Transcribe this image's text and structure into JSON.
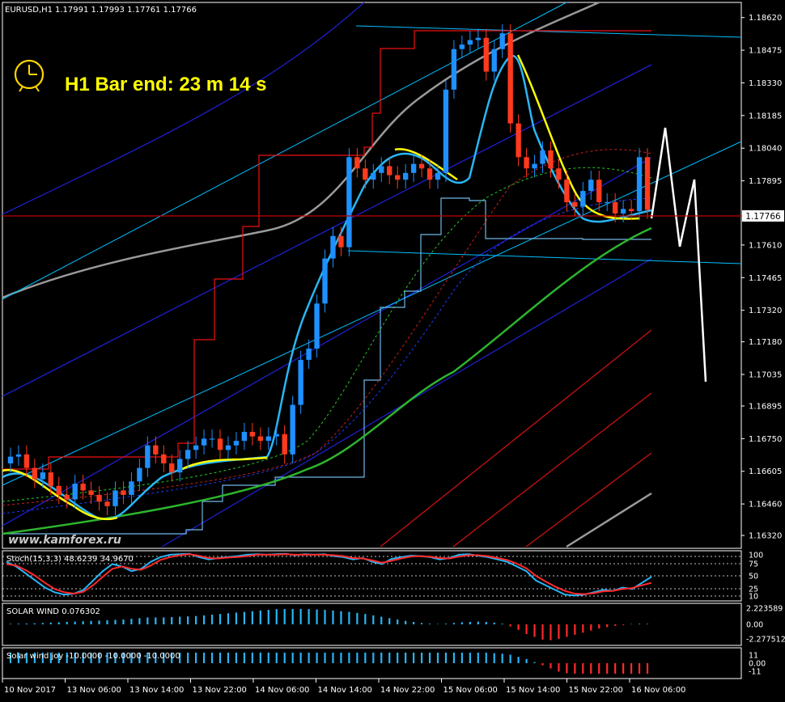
{
  "header": {
    "symbol": "EURUSD,H1",
    "ohlc": "1.17991 1.17993 1.17761 1.17766"
  },
  "timer": {
    "label": "H1 Bar end: 23 m 14 s",
    "icon": "clock-icon"
  },
  "watermark": "www.kamforex.ru",
  "colors": {
    "bull": "#1e90ff",
    "bear": "#ff3a1e",
    "price_line": "#c00000",
    "trend_line": "#00bfff",
    "channel": "#1e1ecc",
    "donchian": "#ff0000",
    "wave": "#1e90ff",
    "signal": "#ffff00",
    "ma_slow": "#2db52d",
    "ma_grey": "#9a9a9a",
    "forecast": "#ffffff",
    "ask_box": "#ff0000"
  },
  "price_marker": "1.17766",
  "chart_data": [
    {
      "type": "candlestick",
      "title": "EURUSD,H1",
      "y_ticks": [
        "1.18620",
        "1.18475",
        "1.18330",
        "1.18185",
        "1.18040",
        "1.17895",
        "1.17610",
        "1.17465",
        "1.17320",
        "1.17180",
        "1.17035",
        "1.16895",
        "1.16750",
        "1.16605",
        "1.16460",
        "1.16320"
      ],
      "ylim": [
        1.1627,
        1.1868
      ],
      "x_ticks": [
        "10 Nov 2017",
        "13 Nov 06:00",
        "13 Nov 14:00",
        "13 Nov 22:00",
        "14 Nov 06:00",
        "14 Nov 14:00",
        "14 Nov 22:00",
        "15 Nov 06:00",
        "15 Nov 14:00",
        "15 Nov 22:00",
        "16 Nov 06:00"
      ],
      "current_price": 1.17766,
      "close": [
        1.1667,
        1.1668,
        1.1662,
        1.1657,
        1.166,
        1.1654,
        1.165,
        1.1648,
        1.1655,
        1.1652,
        1.165,
        1.1647,
        1.1645,
        1.1652,
        1.165,
        1.1656,
        1.1662,
        1.1672,
        1.1668,
        1.1664,
        1.166,
        1.1666,
        1.167,
        1.1672,
        1.1675,
        1.1675,
        1.167,
        1.1672,
        1.1674,
        1.1678,
        1.1676,
        1.1674,
        1.1676,
        1.1677,
        1.1668,
        1.169,
        1.171,
        1.1715,
        1.1735,
        1.1755,
        1.1765,
        1.176,
        1.18,
        1.1795,
        1.179,
        1.1793,
        1.1796,
        1.1792,
        1.179,
        1.1793,
        1.1797,
        1.1795,
        1.179,
        1.1793,
        1.183,
        1.1848,
        1.185,
        1.1852,
        1.1853,
        1.1838,
        1.1848,
        1.1855,
        1.1815,
        1.18,
        1.1795,
        1.1797,
        1.1803,
        1.1795,
        1.179,
        1.178,
        1.1778,
        1.1785,
        1.179,
        1.178,
        1.178,
        1.1775,
        1.1777,
        1.1776,
        1.18,
        1.17766
      ]
    },
    {
      "type": "line",
      "title": "Stoch(15,3,3)",
      "values_text": "48.6239 34.9670",
      "y_ticks": [
        "100",
        "75",
        "50",
        "25",
        "10"
      ],
      "ylim": [
        0,
        100
      ],
      "series": [
        {
          "values": [
            80,
            70,
            55,
            40,
            25,
            15,
            10,
            12,
            20,
            40,
            60,
            75,
            70,
            60,
            65,
            80,
            90,
            95,
            96,
            97,
            90,
            85,
            88,
            90,
            92,
            95,
            96,
            95,
            96,
            97,
            94,
            96,
            95,
            96,
            92,
            90,
            85,
            88,
            80,
            75,
            86,
            90,
            93,
            92,
            90,
            85,
            88,
            95,
            96,
            93,
            90,
            85,
            80,
            70,
            60,
            40,
            30,
            20,
            10,
            8,
            10,
            15,
            20,
            18,
            25,
            22,
            35,
            48
          ]
        },
        {
          "values": [
            75,
            72,
            62,
            50,
            35,
            22,
            15,
            12,
            16,
            30,
            48,
            65,
            70,
            65,
            63,
            72,
            84,
            90,
            94,
            96,
            93,
            88,
            87,
            89,
            90,
            92,
            95,
            95,
            95,
            96,
            95,
            95,
            95,
            95,
            94,
            92,
            88,
            87,
            83,
            78,
            82,
            87,
            91,
            92,
            91,
            88,
            87,
            91,
            94,
            94,
            92,
            88,
            84,
            76,
            66,
            50,
            38,
            27,
            18,
            12,
            11,
            13,
            17,
            18,
            22,
            24,
            30,
            35
          ]
        }
      ]
    },
    {
      "type": "bar",
      "title": "SOLAR WIND",
      "values_text": "0.076302",
      "y_ticks": [
        "2.223589",
        "0.00",
        "-2.277512"
      ],
      "ylim": [
        -2.8,
        2.8
      ],
      "values": [
        0.08,
        0.1,
        0.12,
        0.15,
        0.2,
        0.25,
        0.3,
        0.35,
        0.4,
        0.45,
        0.5,
        0.55,
        0.6,
        0.65,
        0.7,
        0.8,
        0.9,
        1.0,
        1.0,
        1.0,
        1.05,
        1.1,
        1.15,
        1.2,
        1.3,
        1.4,
        1.5,
        1.6,
        1.7,
        1.8,
        1.9,
        2.0,
        2.1,
        2.2,
        2.22,
        2.22,
        2.22,
        2.2,
        2.15,
        2.1,
        2.0,
        1.9,
        1.8,
        1.65,
        1.5,
        1.3,
        1.1,
        0.9,
        0.7,
        0.5,
        0.35,
        0.2,
        0.1,
        0.05,
        0.1,
        0.2,
        0.3,
        0.35,
        0.4,
        0.35,
        0.25,
        0.1,
        -0.3,
        -0.8,
        -1.4,
        -1.8,
        -2.2,
        -2.28,
        -2.1,
        -1.8,
        -1.5,
        -1.2,
        -0.9,
        -0.6,
        -0.4,
        -0.2,
        -0.1,
        0.05,
        0.08,
        0.07
      ]
    },
    {
      "type": "bar",
      "title": "Solar wind joy",
      "values_text": "-10.0000 -10.0000 -10.0000",
      "y_ticks": [
        "11",
        "0.00",
        "-11"
      ],
      "ylim": [
        -13,
        13
      ],
      "values": [
        10,
        10,
        10,
        10,
        10,
        10,
        10,
        10,
        10,
        10,
        10,
        10,
        10,
        10,
        10,
        10,
        10,
        10,
        10,
        10,
        10,
        10,
        10,
        10,
        10,
        10,
        10,
        10,
        10,
        10,
        10,
        10,
        10,
        10,
        10,
        10,
        10,
        10,
        10,
        10,
        10,
        10,
        10,
        10,
        10,
        10,
        10,
        10,
        10,
        10,
        10,
        10,
        10,
        10,
        10,
        10,
        10,
        10,
        10,
        10,
        9.5,
        9,
        8,
        6,
        4,
        1,
        -2,
        -5,
        -8,
        -9.5,
        -10,
        -10,
        -10,
        -10,
        -10,
        -10,
        -10,
        -10,
        -10,
        -10
      ]
    }
  ]
}
